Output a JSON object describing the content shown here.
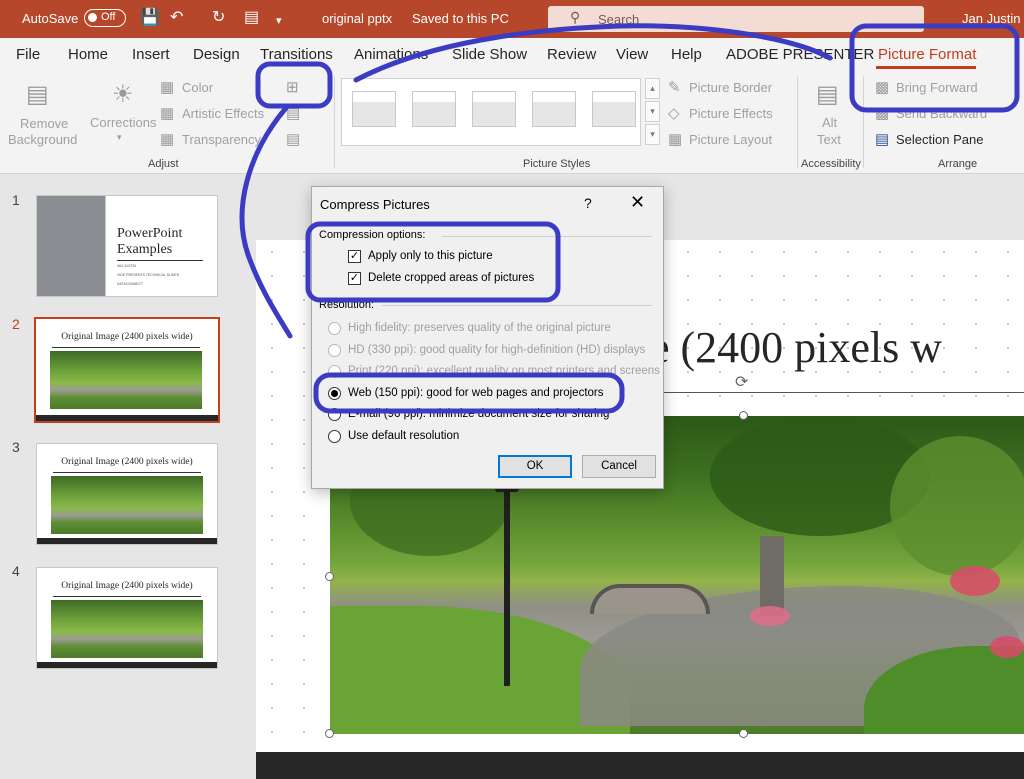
{
  "titlebar": {
    "autosave_label": "AutoSave",
    "autosave_state": "Off",
    "document_title": "original pptx",
    "save_status": "Saved to this PC",
    "search_placeholder": "Search",
    "user_name": "Jan Justin"
  },
  "tabs": [
    "File",
    "Home",
    "Insert",
    "Design",
    "Transitions",
    "Animations",
    "Slide Show",
    "Review",
    "View",
    "Help",
    "ADOBE PRESENTER",
    "Picture Format"
  ],
  "active_tab": "Picture Format",
  "ribbon": {
    "remove_background": "Remove Background",
    "corrections": "Corrections",
    "color": "Color",
    "artistic_effects": "Artistic Effects",
    "transparency": "Transparency",
    "adjust_group": "Adjust",
    "picture_border": "Picture Border",
    "picture_effects": "Picture Effects",
    "picture_layout": "Picture Layout",
    "picture_styles_group": "Picture Styles",
    "alt_text": "Alt Text",
    "accessibility_group": "Accessibility",
    "bring_forward": "Bring Forward",
    "send_backward": "Send Backward",
    "selection_pane": "Selection Pane",
    "arrange_group": "Arrange"
  },
  "slides": [
    {
      "number": "1",
      "title_line1": "PowerPoint",
      "title_line2": "Examples",
      "author": "IAN JUSTIN",
      "subtitle": "VIDE PRESENTS TECHNICAL SLIDES",
      "footer": "DATACONNECT"
    },
    {
      "number": "2",
      "title": "Original Image (2400 pixels wide)"
    },
    {
      "number": "3",
      "title": "Original Image (2400 pixels wide)"
    },
    {
      "number": "4",
      "title": "Original Image (2400 pixels wide)"
    }
  ],
  "slide_title_visible": "e (2400 pixels w",
  "dialog": {
    "title": "Compress Pictures",
    "help": "?",
    "close": "✕",
    "compression_label": "Compression options:",
    "apply_only": "Apply only to this picture",
    "delete_cropped": "Delete cropped areas of pictures",
    "resolution_label": "Resolution:",
    "options": [
      {
        "label": "High fidelity: preserves quality of the original picture",
        "state": "disabled"
      },
      {
        "label": "HD (330 ppi): good quality for high-definition (HD) displays",
        "state": "disabled"
      },
      {
        "label": "Print (220 ppi): excellent quality on most printers and screens",
        "state": "disabled"
      },
      {
        "label": "Web (150 ppi): good for web pages and projectors",
        "state": "selected"
      },
      {
        "label": "E-mail (96 ppi): minimize document size for sharing",
        "state": "enabled"
      },
      {
        "label": "Use default resolution",
        "state": "enabled"
      }
    ],
    "ok": "OK",
    "cancel": "Cancel"
  },
  "colors": {
    "accent": "#b7472a",
    "annotation": "#3b3bc4",
    "selected_tab": "#c43e1c"
  }
}
